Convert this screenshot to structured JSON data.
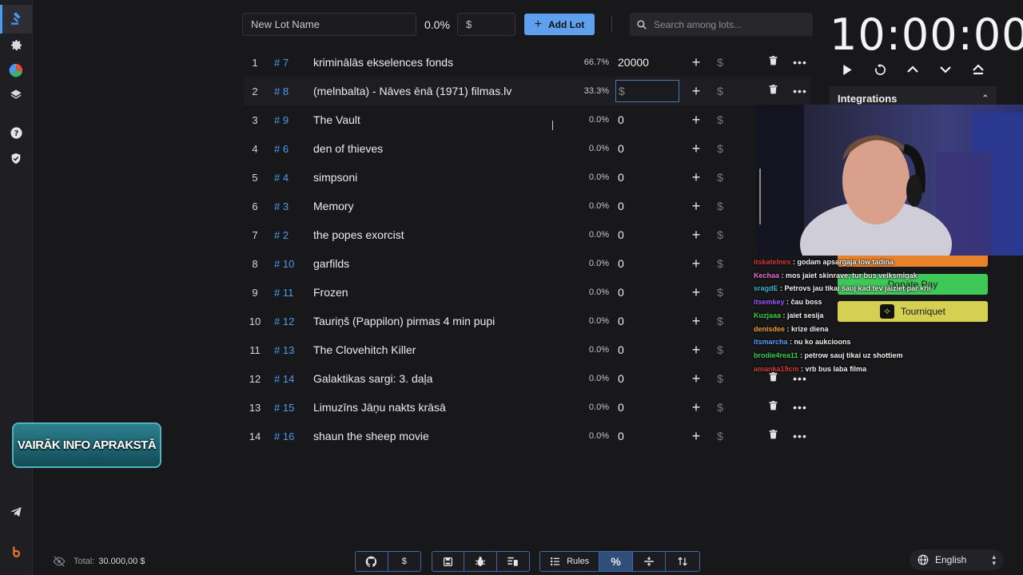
{
  "sidebar": {
    "items": [
      {
        "name": "gavel-icon",
        "label": "Auction"
      },
      {
        "name": "gear-icon",
        "label": "Settings"
      },
      {
        "name": "wheel-icon",
        "label": "Wheel"
      },
      {
        "name": "layers-icon",
        "label": "Layers"
      },
      {
        "name": "help-icon",
        "label": "Help"
      },
      {
        "name": "shield-icon",
        "label": "Security"
      },
      {
        "name": "telegram-icon",
        "label": "Telegram"
      },
      {
        "name": "brand-icon",
        "label": "Brand"
      }
    ]
  },
  "toolbar": {
    "new_lot_placeholder": "New Lot Name",
    "percent": "0.0%",
    "amount_placeholder": "$",
    "add_lot_label": "Add Lot",
    "search_placeholder": "Search among lots..."
  },
  "lots": [
    {
      "num": "1",
      "id": "# 7",
      "name": "kriminālās ekselences fonds",
      "pct": "66.7%",
      "amount": "20000"
    },
    {
      "num": "2",
      "id": "# 8",
      "name": "(melnbalta) - Nāves ēnā (1971) filmas.lv",
      "pct": "33.3%",
      "amount": "$"
    },
    {
      "num": "3",
      "id": "# 9",
      "name": "The Vault",
      "pct": "0.0%",
      "amount": "0"
    },
    {
      "num": "4",
      "id": "# 6",
      "name": "den of thieves",
      "pct": "0.0%",
      "amount": "0"
    },
    {
      "num": "5",
      "id": "# 4",
      "name": "simpsoni",
      "pct": "0.0%",
      "amount": "0"
    },
    {
      "num": "6",
      "id": "# 3",
      "name": "Memory",
      "pct": "0.0%",
      "amount": "0"
    },
    {
      "num": "7",
      "id": "# 2",
      "name": "the popes exorcist",
      "pct": "0.0%",
      "amount": "0"
    },
    {
      "num": "8",
      "id": "# 10",
      "name": "garfilds",
      "pct": "0.0%",
      "amount": "0"
    },
    {
      "num": "9",
      "id": "# 11",
      "name": "Frozen",
      "pct": "0.0%",
      "amount": "0"
    },
    {
      "num": "10",
      "id": "# 12",
      "name": "Tauriņš (Pappilon) pirmas 4 min pupi",
      "pct": "0.0%",
      "amount": "0"
    },
    {
      "num": "11",
      "id": "# 13",
      "name": "The Clovehitch Killer",
      "pct": "0.0%",
      "amount": "0"
    },
    {
      "num": "12",
      "id": "# 14",
      "name": "Galaktikas sargi: 3. daļa",
      "pct": "0.0%",
      "amount": "0"
    },
    {
      "num": "13",
      "id": "# 15",
      "name": "Limuzīns Jāņu nakts krāsā",
      "pct": "0.0%",
      "amount": "0"
    },
    {
      "num": "14",
      "id": "# 16",
      "name": "shaun the sheep movie",
      "pct": "0.0%",
      "amount": "0"
    }
  ],
  "timer": {
    "value": "10:00:00"
  },
  "integrations": {
    "title": "Integrations",
    "donate_label": "Donate Pay",
    "tourniquet_label": "Tourniquet"
  },
  "chat": [
    {
      "user": "itskatelnes",
      "msg": "godam apsargaja low tadina",
      "color": "#d23c3c"
    },
    {
      "user": "Kechaa",
      "msg": "mos jaiet skinrave, tur bus veiksmigak",
      "color": "#e66bd6"
    },
    {
      "user": "sragdE",
      "msg": "Petrovs jau tikai šauj kad tev jāiziet par krii",
      "color": "#3cb4d2"
    },
    {
      "user": "itsemkey",
      "msg": "čau boss",
      "color": "#9b59ff"
    },
    {
      "user": "Kuzjaaa",
      "msg": "jaiet sesija",
      "color": "#37d24b"
    },
    {
      "user": "denisdee",
      "msg": "krize diena",
      "color": "#f0a030"
    },
    {
      "user": "itsmarcha",
      "msg": "nu ko aukcioons",
      "color": "#5aa0ff"
    },
    {
      "user": "brodie4rea11",
      "msg": "petrow sauj tikai uz shottiem",
      "color": "#37d24b"
    },
    {
      "user": "amanka19cm",
      "msg": "vrb bus laba filma",
      "color": "#d23c3c"
    }
  ],
  "promo": {
    "text": "VAIRĀK INFO APRAKSTĀ"
  },
  "footer": {
    "total_label": "Total:",
    "total_value": "30.000,00 $",
    "rules_label": "Rules",
    "dollar_label": "$",
    "percent_label": "%",
    "language": "English"
  },
  "colors": {
    "accent": "#4a9bf0",
    "add_button": "#5fa0ee",
    "donate_green": "#3fc758",
    "tourniquet_yellow": "#d6d052",
    "alert_orange": "#e8822a"
  }
}
